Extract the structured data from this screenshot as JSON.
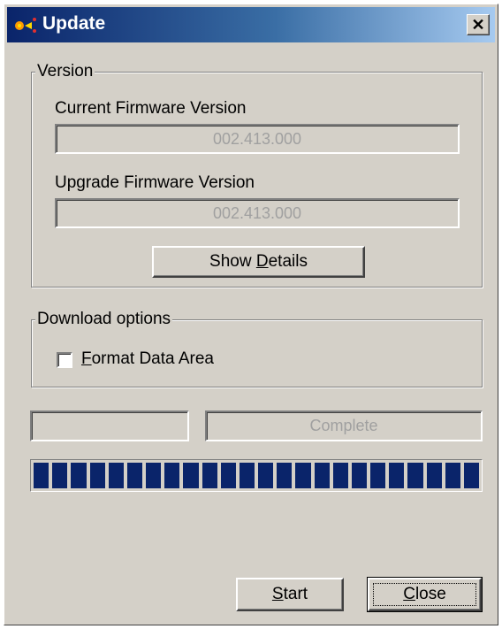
{
  "window": {
    "title": "Update",
    "close_glyph": "✕",
    "accent_color": "#0a246a"
  },
  "version_group": {
    "legend": "Version",
    "current_label": "Current Firmware Version",
    "current_value": "002.413.000",
    "upgrade_label": "Upgrade Firmware Version",
    "upgrade_value": "002.413.000",
    "details_button": {
      "before": "Show ",
      "mnemonic": "D",
      "after": "etails"
    }
  },
  "download_group": {
    "legend": "Download options",
    "format_checkbox": {
      "mnemonic": "F",
      "after": "ormat Data Area",
      "checked": false
    }
  },
  "status": {
    "left_value": "",
    "right_value": "Complete"
  },
  "progress": {
    "fraction": 1.0,
    "block_count": 24,
    "color": "#0a246a"
  },
  "buttons": {
    "start": {
      "mnemonic": "S",
      "after": "tart"
    },
    "close": {
      "mnemonic": "C",
      "after": "lose"
    }
  }
}
